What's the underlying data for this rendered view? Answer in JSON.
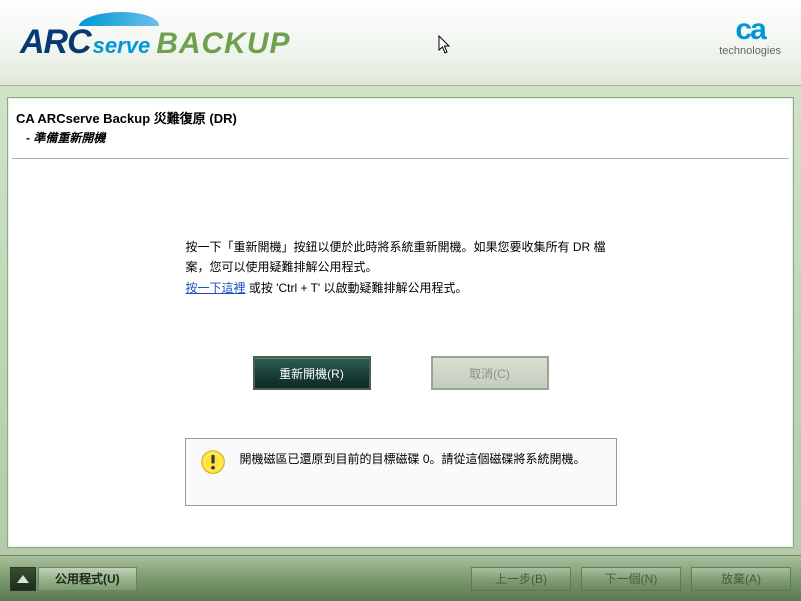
{
  "brand": {
    "arc": "ARC",
    "serve": "serve",
    "backup": "BACKUP",
    "ca": "ca",
    "tech": "technologies"
  },
  "page": {
    "title": "CA ARCserve Backup 災難復原 (DR)",
    "subtitle": "- 準備重新開機"
  },
  "body": {
    "line1": "按一下「重新開機」按鈕以便於此時將系統重新開機。如果您要收集所有 DR 檔案，您可以使用疑難排解公用程式。",
    "link": "按一下這裡",
    "line2_rest": " 或按 'Ctrl + T' 以啟動疑難排解公用程式。"
  },
  "buttons": {
    "reboot": "重新開機(R)",
    "cancel": "取消(C)"
  },
  "info": {
    "text": "開機磁區已還原到目前的目標磁碟 0。請從這個磁碟將系統開機。"
  },
  "footer": {
    "utilities": "公用程式(U)",
    "back": "上一步(B)",
    "next": "下一個(N)",
    "abort": "放棄(A)"
  }
}
